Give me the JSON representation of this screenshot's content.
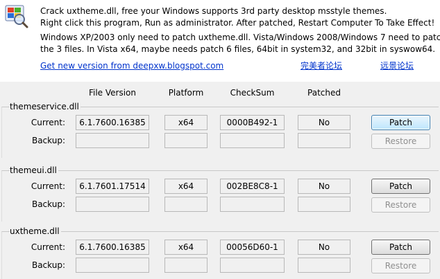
{
  "header": {
    "line1": "Crack uxtheme.dll, free your Windows supports 3rd party desktop msstyle themes.",
    "line2": "Right click this program, Run as administrator.     After patched, Restart Computer To Take Effect!",
    "line3": "Windows XP/2003 only need to patch uxtheme.dll. Vista/Windows 2008/Windows 7 need to patch",
    "line4": "the 3 files. In Vista x64, maybe needs patch 6 files, 64bit in system32, and 32bit in syswow64."
  },
  "links": {
    "new_version": "Get new version from deepxw.blogspot.com",
    "forum1": "完美者论坛",
    "forum2": "远景论坛"
  },
  "columns": {
    "file_version": "File Version",
    "platform": "Platform",
    "checksum": "CheckSum",
    "patched": "Patched"
  },
  "labels": {
    "current": "Current:",
    "backup": "Backup:"
  },
  "groups": [
    {
      "name": "themeservice.dll",
      "current": {
        "version": "6.1.7600.16385",
        "platform": "x64",
        "checksum": "0000B492-1",
        "patched": "No"
      },
      "backup": {
        "version": "",
        "platform": "",
        "checksum": "",
        "patched": ""
      },
      "patch_label": "Patch",
      "restore_label": "Restore"
    },
    {
      "name": "themeui.dll",
      "current": {
        "version": "6.1.7601.17514",
        "platform": "x64",
        "checksum": "002BE8C8-1",
        "patched": "No"
      },
      "backup": {
        "version": "",
        "platform": "",
        "checksum": "",
        "patched": ""
      },
      "patch_label": "Patch",
      "restore_label": "Restore"
    },
    {
      "name": "uxtheme.dll",
      "current": {
        "version": "6.1.7600.16385",
        "platform": "x64",
        "checksum": "00056D60-1",
        "patched": "No"
      },
      "backup": {
        "version": "",
        "platform": "",
        "checksum": "",
        "patched": ""
      },
      "patch_label": "Patch",
      "restore_label": "Restore"
    }
  ],
  "icons": {
    "app": "windows-theme-magnifier-icon"
  }
}
